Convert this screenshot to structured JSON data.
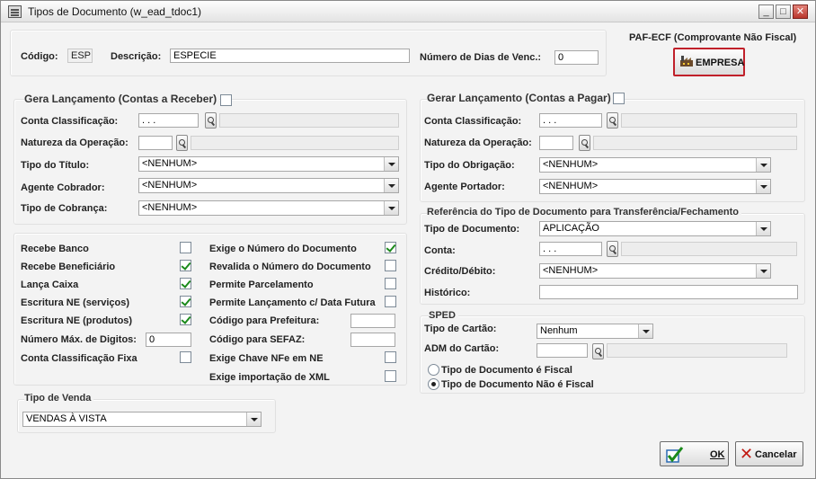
{
  "window": {
    "title": "Tipos de Documento (w_ead_tdoc1)",
    "minimize_glyph": "_",
    "maximize_glyph": "□",
    "close_glyph": "✕"
  },
  "header": {
    "codigo_label": "Código:",
    "codigo_value": "ESP",
    "descricao_label": "Descrição:",
    "descricao_value": "ESPECIE",
    "dias_label": "Número de Dias de Venc.:",
    "dias_value": "0",
    "paf_label": "PAF-ECF (Comprovante Não Fiscal)",
    "empresa_button": "EMPRESA"
  },
  "receber": {
    "title": "Gera Lançamento (Contas a Receber)",
    "conta_label": "Conta Classificação:",
    "conta_value": ". . .",
    "natureza_label": "Natureza da Operação:",
    "tipo_titulo_label": "Tipo do Título:",
    "tipo_titulo_value": "<NENHUM>",
    "agente_label": "Agente Cobrador:",
    "agente_value": "<NENHUM>",
    "cobranca_label": "Tipo de Cobrança:",
    "cobranca_value": "<NENHUM>"
  },
  "pagar": {
    "title": "Gerar Lançamento (Contas a Pagar)",
    "conta_label": "Conta Classificação:",
    "conta_value": ". . .",
    "natureza_label": "Natureza da Operação:",
    "tipo_obrigacao_label": "Tipo do Obrigação:",
    "tipo_obrigacao_value": "<NENHUM>",
    "agente_label": "Agente Portador:",
    "agente_value": "<NENHUM>"
  },
  "options": {
    "recebe_banco": "Recebe Banco",
    "recebe_beneficiario": "Recebe Beneficiário",
    "lanca_caixa": "Lança Caixa",
    "escritura_servicos": "Escritura NE (serviços)",
    "escritura_produtos": "Escritura NE (produtos)",
    "max_digitos_label": "Número Máx. de Digitos:",
    "max_digitos_value": "0",
    "conta_fixa": "Conta Classificação Fixa",
    "exige_numero": "Exige o Número do Documento",
    "revalida_numero": "Revalida o Número do Documento",
    "permite_parcelamento": "Permite Parcelamento",
    "permite_lancamento": "Permite Lançamento c/ Data Futura",
    "codigo_prefeitura": "Código para Prefeitura:",
    "codigo_sefaz": "Código para SEFAZ:",
    "exige_chave": "Exige Chave NFe em NE",
    "exige_xml": "Exige importação de XML"
  },
  "referencia": {
    "title": "Referência do Tipo de Documento para Transferência/Fechamento",
    "tipo_doc_label": "Tipo de Documento:",
    "tipo_doc_value": "APLICAÇÃO",
    "conta_label": "Conta:",
    "conta_value": ". . .",
    "credito_label": "Crédito/Débito:",
    "credito_value": "<NENHUM>",
    "historico_label": "Histórico:"
  },
  "sped": {
    "title": "SPED",
    "tipo_cartao_label": "Tipo de Cartão:",
    "tipo_cartao_value": "Nenhum",
    "adm_label": "ADM  do Cartão:",
    "fiscal_label": "Tipo de Documento é Fiscal",
    "nao_fiscal_label": "Tipo de Documento Não é Fiscal"
  },
  "venda": {
    "title": "Tipo de Venda",
    "value": "VENDAS À VISTA"
  },
  "buttons": {
    "ok": "OK",
    "cancel": "Cancelar"
  },
  "colors": {
    "checkmark": "#1b8a1b",
    "cancel_icon": "#c21a12",
    "empresa_border": "#c0202a"
  }
}
